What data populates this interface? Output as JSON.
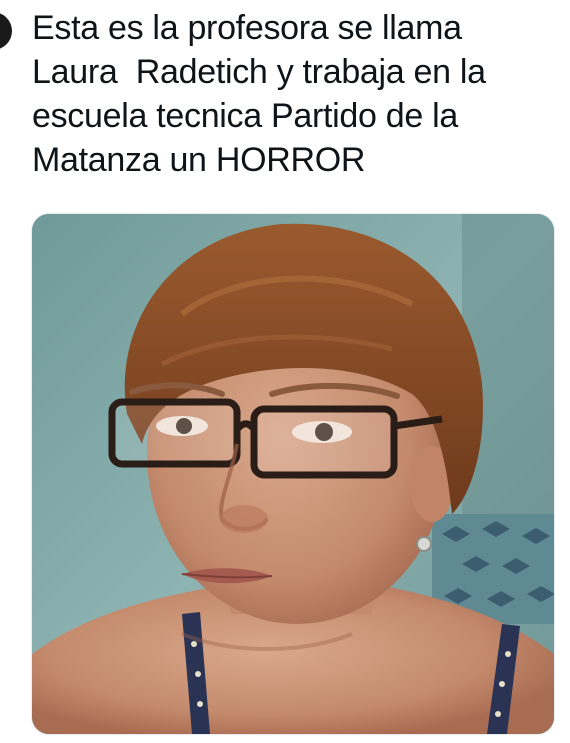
{
  "tweet": {
    "text_lines": [
      "Esta es la profesora se llama",
      "Laura  Radetich y trabaja en la",
      "escuela tecnica Partido de la",
      "Matanza un HORROR"
    ]
  },
  "media": {
    "type": "photo",
    "subject": "portrait-photo"
  },
  "colors": {
    "text": "#0f1419",
    "background": "#ffffff",
    "photo_wall": "#7fa6a5",
    "hair": "#8a4a22",
    "skin": "#c99376"
  }
}
